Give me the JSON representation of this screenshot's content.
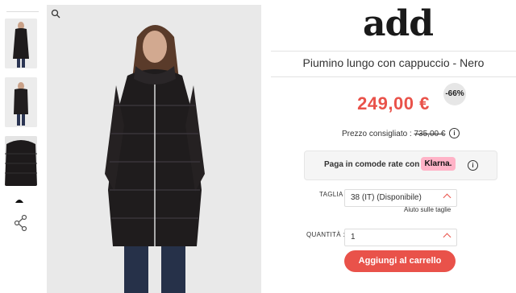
{
  "top_text": "...",
  "brand": {
    "logo_text": "add"
  },
  "product": {
    "title": "Piumino lungo con cappuccio - Nero",
    "price": "249,00 €",
    "discount_badge": "-66%",
    "rrp_label": "Prezzo consigliato :",
    "rrp_value": "735,00 €"
  },
  "klarna": {
    "text": "Paga in comode rate con",
    "logo": "Klarna."
  },
  "size": {
    "label": "TAGLIA :",
    "value": "38 (IT) (Disponibile)",
    "guide_link": "Aiuto sulle taglie"
  },
  "quantity": {
    "label": "QUANTITÀ :",
    "value": "1"
  },
  "cart_button": "Aggiungi al carrello",
  "icons": [
    "zoom-icon",
    "share-icon",
    "info-icon",
    "chevron-up-icon"
  ],
  "colors": {
    "accent": "#e9524a",
    "klarna_pink": "#ffb3c7",
    "coat": "#1c1a1b"
  }
}
